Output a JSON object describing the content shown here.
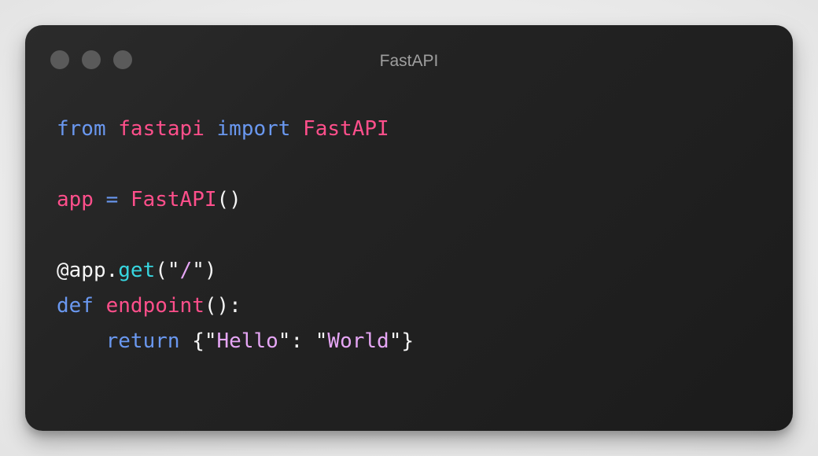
{
  "window": {
    "title": "FastAPI",
    "colors": {
      "keyword": "#6a98f0",
      "identifier": "#ff4f8b",
      "plain": "#f5f5f5",
      "method": "#37d6e0",
      "string": "#e6a6f5",
      "background": "#1f1f1f",
      "window_dot": "#5a5a5a"
    },
    "traffic_lights": [
      "close-dot",
      "minimize-dot",
      "zoom-dot"
    ]
  },
  "code_lines": [
    {
      "tokens": [
        {
          "text": "from",
          "role": "keyword"
        },
        {
          "text": " ",
          "role": "plain"
        },
        {
          "text": "fastapi",
          "role": "identifier"
        },
        {
          "text": " ",
          "role": "plain"
        },
        {
          "text": "import",
          "role": "keyword"
        },
        {
          "text": " ",
          "role": "plain"
        },
        {
          "text": "FastAPI",
          "role": "identifier"
        }
      ]
    },
    {
      "tokens": []
    },
    {
      "tokens": [
        {
          "text": "app",
          "role": "identifier"
        },
        {
          "text": " ",
          "role": "plain"
        },
        {
          "text": "=",
          "role": "keyword"
        },
        {
          "text": " ",
          "role": "plain"
        },
        {
          "text": "FastAPI",
          "role": "identifier"
        },
        {
          "text": "()",
          "role": "plain"
        }
      ]
    },
    {
      "tokens": []
    },
    {
      "tokens": [
        {
          "text": "@app.",
          "role": "plain"
        },
        {
          "text": "get",
          "role": "method"
        },
        {
          "text": "(\"",
          "role": "plain"
        },
        {
          "text": "/",
          "role": "string"
        },
        {
          "text": "\")",
          "role": "plain"
        }
      ]
    },
    {
      "tokens": [
        {
          "text": "def",
          "role": "keyword"
        },
        {
          "text": " ",
          "role": "plain"
        },
        {
          "text": "endpoint",
          "role": "identifier"
        },
        {
          "text": "():",
          "role": "plain"
        }
      ]
    },
    {
      "tokens": [
        {
          "text": "    ",
          "role": "plain"
        },
        {
          "text": "return",
          "role": "keyword"
        },
        {
          "text": " {\"",
          "role": "plain"
        },
        {
          "text": "Hello",
          "role": "string"
        },
        {
          "text": "\": \"",
          "role": "plain"
        },
        {
          "text": "World",
          "role": "string"
        },
        {
          "text": "\"}",
          "role": "plain"
        }
      ]
    }
  ]
}
